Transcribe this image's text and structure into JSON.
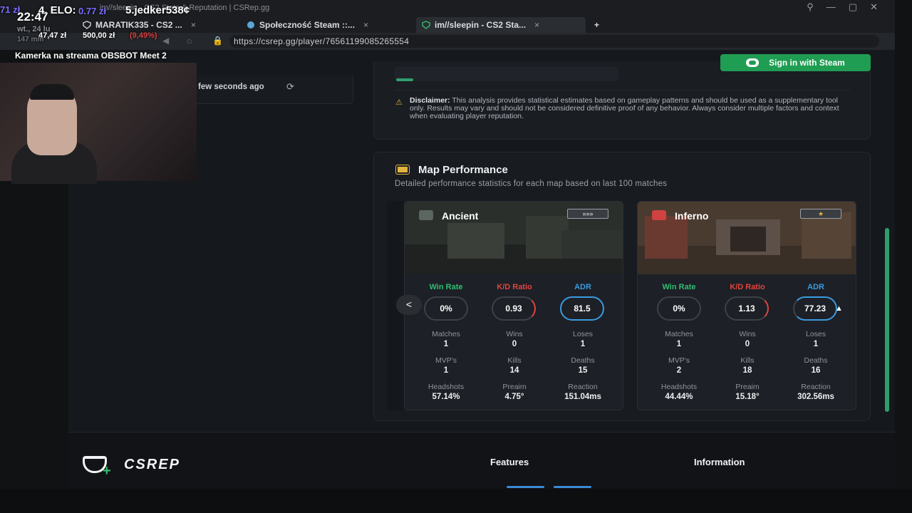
{
  "browser": {
    "window_title": "im//sleepin - CS2 Stats & Reputation | CSRep.gg",
    "tabs": [
      {
        "label": "MARATIK335 - CS2 ...",
        "close": "×"
      },
      {
        "label": "Społeczność Steam ::...",
        "close": "×"
      },
      {
        "label": "im//sleepin - CS2 Sta...",
        "close": "×"
      }
    ],
    "new_tab": "+",
    "url": "https://csrep.gg/player/76561199085265554"
  },
  "header": {
    "sign_in_label": "Sign in with Steam"
  },
  "profile": {
    "updated_text": "few seconds ago"
  },
  "disclaimer": {
    "title": "Disclaimer:",
    "text": "This analysis provides statistical estimates based on gameplay patterns and should be used as a supplementary tool only. Results may vary and should not be considered definitive proof of any behavior. Always consider multiple factors and context when evaluating player reputation."
  },
  "map_performance": {
    "title": "Map Performance",
    "subtitle": "Detailed performance statistics for each map based on last 100 matches",
    "prev_label": "<",
    "stat_headers": {
      "win_rate": "Win Rate",
      "kd": "K/D Ratio",
      "adr": "ADR"
    },
    "labels": {
      "matches": "Matches",
      "wins": "Wins",
      "loses": "Loses",
      "mvps": "MVP's",
      "kills": "Kills",
      "deaths": "Deaths",
      "headshots": "Headshots",
      "preaim": "Preaim",
      "reaction": "Reaction"
    },
    "maps": [
      {
        "name": "Ancient",
        "rank": "»»»",
        "win_rate": "0%",
        "kd": "0.93",
        "adr": "81.5",
        "matches": "1",
        "wins": "0",
        "loses": "1",
        "mvps": "1",
        "kills": "14",
        "deaths": "15",
        "headshots": "57.14%",
        "preaim": "4.75°",
        "reaction": "151.04ms"
      },
      {
        "name": "Inferno",
        "rank": "★",
        "win_rate": "0%",
        "kd": "1.13",
        "adr": "77.23",
        "matches": "1",
        "wins": "0",
        "loses": "1",
        "mvps": "2",
        "kills": "18",
        "deaths": "16",
        "headshots": "44.44%",
        "preaim": "15.18°",
        "reaction": "302.56ms"
      }
    ]
  },
  "footer": {
    "logo_text": "CSREP",
    "features": "Features",
    "information": "Information"
  },
  "stream_overlay": {
    "time": "22:47",
    "elo_text": "4. ELO:",
    "elo_value": "0.77 zł",
    "left_value": "71 zł",
    "player": "5.jedker538¢",
    "date": "wt., 24 lu",
    "donate_current": "47,47 zł",
    "donate_goal": "500,00 zł",
    "donate_pct": "(9,49%)",
    "small_num": "147 mm",
    "camera_label": "Kamerka na streama OBSBOT Meet 2"
  },
  "colors": {
    "accent_green": "#1f9d53",
    "win_rate": "#2fbf71",
    "kd": "#e0443e",
    "adr": "#3a9be0"
  }
}
